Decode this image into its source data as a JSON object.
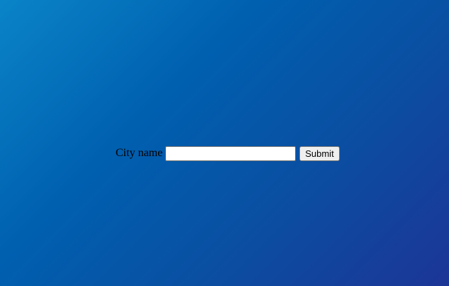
{
  "form": {
    "city_label": "City name",
    "city_input_value": "",
    "city_input_placeholder": "",
    "submit_label": "Submit"
  },
  "colors": {
    "background_gradient_start": "#0a84c8",
    "background_gradient_mid": "#0060b0",
    "background_gradient_end": "#1c3596",
    "button_background": "#efefef",
    "input_background": "#ffffff",
    "label_text": "#000000"
  }
}
